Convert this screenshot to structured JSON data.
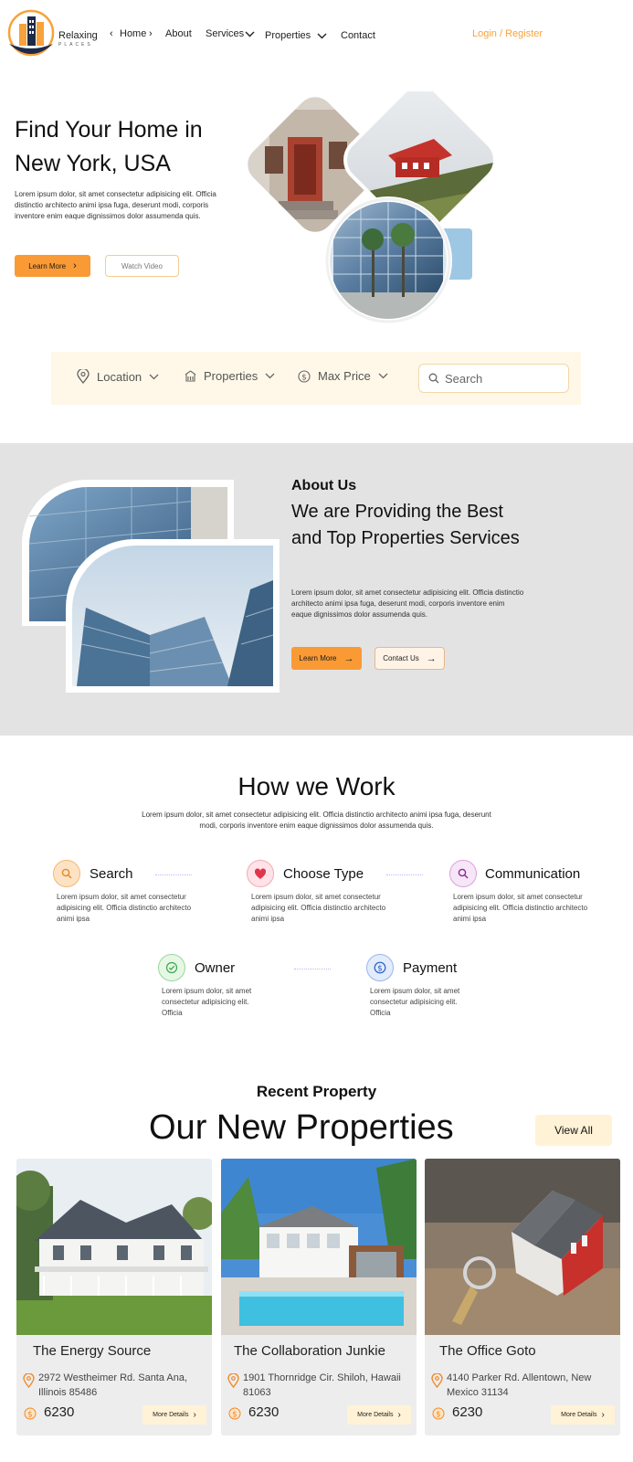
{
  "brand": {
    "name": "Relaxing",
    "sub": "PLACES"
  },
  "nav": {
    "items": [
      "Home",
      "About",
      "Services",
      "Properties",
      "Contact"
    ],
    "login": "Login",
    "register": "/ Register"
  },
  "hero": {
    "title": "Find Your Home in New York, USA",
    "text": "Lorem ipsum dolor, sit amet consectetur adipisicing elit. Officia distinctio architecto animi ipsa fuga, deserunt modi, corporis inventore enim eaque dignissimos dolor assumenda quis.",
    "learn_more": "Learn More",
    "watch_video": "Watch Video"
  },
  "search": {
    "location": "Location",
    "properties": "Properties",
    "max_price": "Max Price",
    "placeholder": "Search"
  },
  "about": {
    "kicker": "About Us",
    "title": "We are Providing the Best and Top Properties Services",
    "text": "Lorem ipsum dolor, sit amet consectetur adipisicing elit. Officia distinctio architecto animi ipsa fuga, deserunt modi, corporis inventore enim eaque dignissimos dolor assumenda quis.",
    "learn_more": "Learn More",
    "contact_us": "Contact Us"
  },
  "how": {
    "title": "How we Work",
    "text": "Lorem ipsum dolor, sit amet consectetur adipisicing elit. Officia distinctio architecto animi ipsa fuga, deserunt modi, corporis inventore enim eaque dignissimos dolor assumenda quis.",
    "steps": [
      {
        "title": "Search",
        "text": "Lorem ipsum dolor, sit amet consectetur adipisicing elit. Officia distinctio architecto animi ipsa"
      },
      {
        "title": "Choose Type",
        "text": "Lorem ipsum dolor, sit amet consectetur adipisicing elit. Officia distinctio architecto animi ipsa"
      },
      {
        "title": "Communication",
        "text": "Lorem ipsum dolor, sit amet consectetur adipisicing elit. Officia distinctio architecto animi ipsa"
      },
      {
        "title": "Owner",
        "text": "Lorem ipsum dolor, sit amet consectetur adipisicing elit. Officia"
      },
      {
        "title": "Payment",
        "text": "Lorem ipsum dolor, sit amet consectetur adipisicing elit. Officia"
      }
    ]
  },
  "properties": {
    "kicker": "Recent Property",
    "title": "Our New Properties",
    "view_all": "View All",
    "cards": [
      {
        "name": "The Energy Source",
        "address": "2972 Westheimer Rd. Santa Ana, Illinois 85486",
        "price": "6230",
        "button": "More Details"
      },
      {
        "name": "The Collaboration Junkie",
        "address": "1901 Thornridge Cir. Shiloh, Hawaii 81063",
        "price": "6230",
        "button": "More Details"
      },
      {
        "name": "The Office Goto",
        "address": "4140 Parker Rd. Allentown, New Mexico 31134",
        "price": "6230",
        "button": "More Details"
      }
    ]
  },
  "colors": {
    "accent": "#f99a35",
    "cream": "#fff2d6",
    "gray_band": "#e3e3e3",
    "navy": "#1e2a4a"
  }
}
